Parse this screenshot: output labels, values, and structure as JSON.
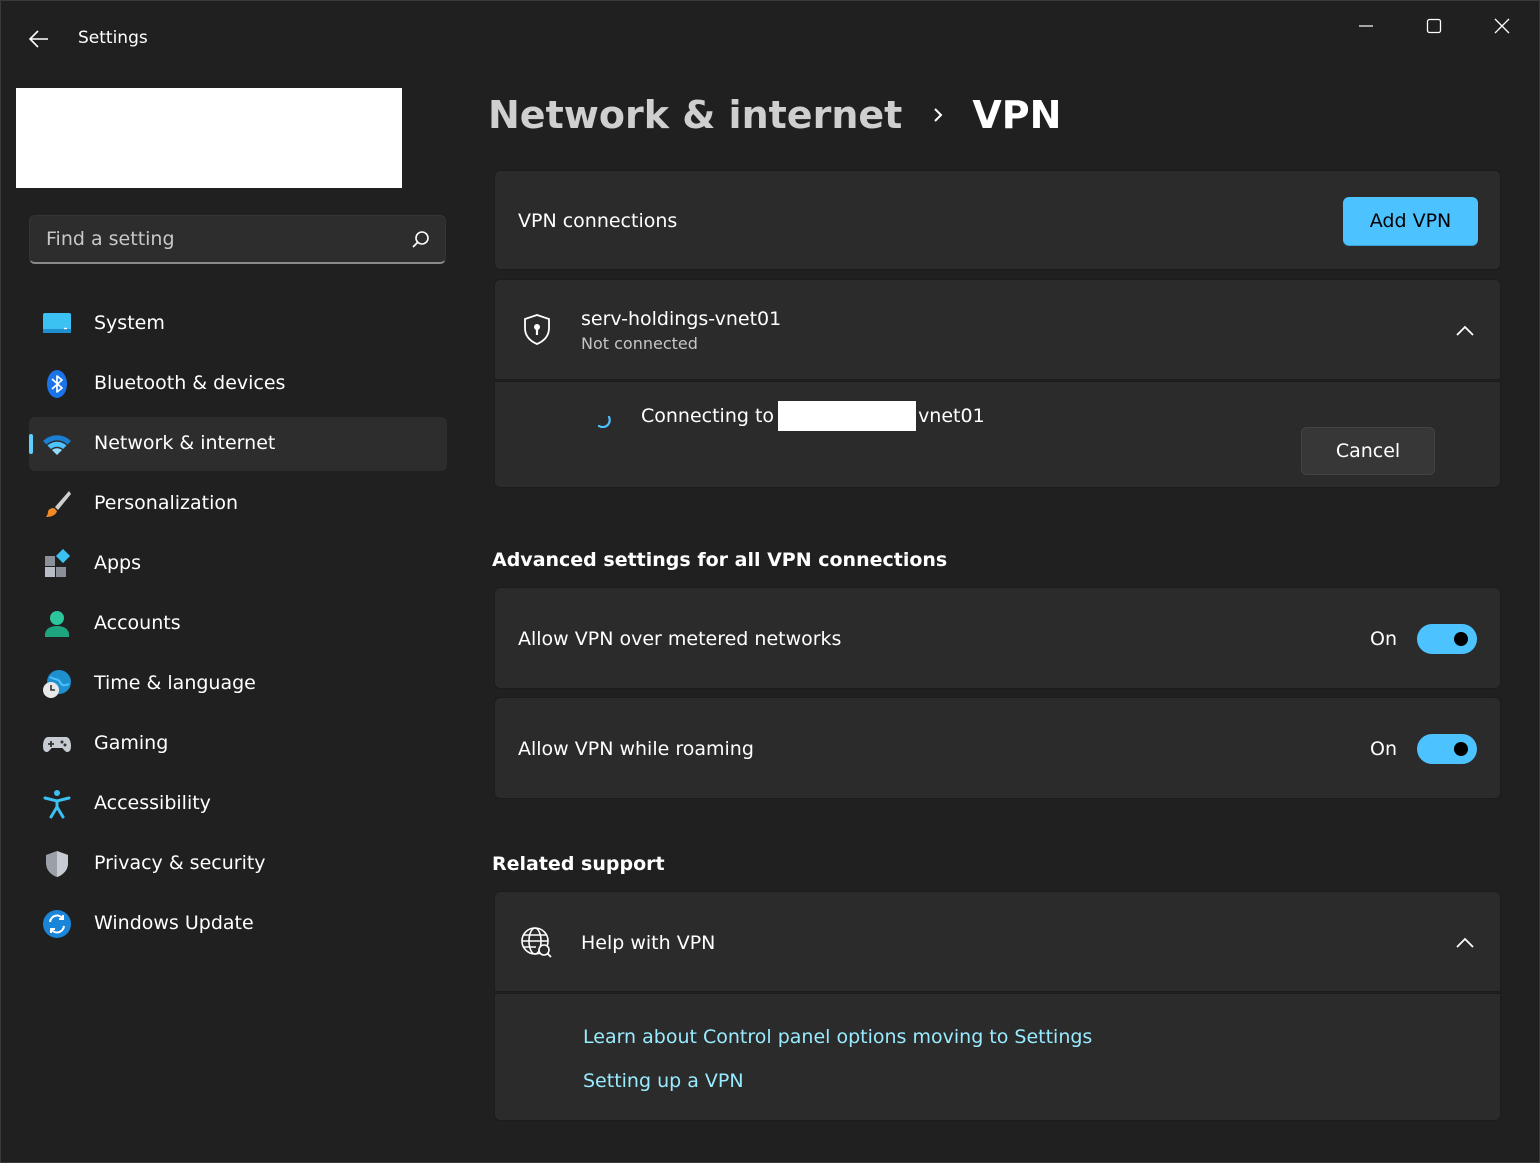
{
  "window": {
    "title": "Settings"
  },
  "search": {
    "placeholder": "Find a setting"
  },
  "sidebar": {
    "items": [
      {
        "label": "System",
        "icon": "monitor-icon"
      },
      {
        "label": "Bluetooth & devices",
        "icon": "bluetooth-icon"
      },
      {
        "label": "Network & internet",
        "icon": "wifi-icon",
        "active": true
      },
      {
        "label": "Personalization",
        "icon": "paintbrush-icon"
      },
      {
        "label": "Apps",
        "icon": "apps-icon"
      },
      {
        "label": "Accounts",
        "icon": "person-icon"
      },
      {
        "label": "Time & language",
        "icon": "globe-clock-icon"
      },
      {
        "label": "Gaming",
        "icon": "gamepad-icon"
      },
      {
        "label": "Accessibility",
        "icon": "accessibility-icon"
      },
      {
        "label": "Privacy & security",
        "icon": "shield-icon"
      },
      {
        "label": "Windows Update",
        "icon": "update-icon"
      }
    ]
  },
  "breadcrumb": {
    "parent": "Network & internet",
    "current": "VPN"
  },
  "vpn_connections": {
    "title": "VPN connections",
    "add_label": "Add VPN"
  },
  "vpn_item": {
    "name": "serv-holdings-vnet01",
    "status": "Not connected",
    "connecting_prefix": "Connecting to",
    "connecting_suffix": "vnet01",
    "cancel_label": "Cancel"
  },
  "advanced": {
    "title": "Advanced settings for all VPN connections",
    "metered": {
      "label": "Allow VPN over metered networks",
      "state": "On",
      "on": true
    },
    "roaming": {
      "label": "Allow VPN while roaming",
      "state": "On",
      "on": true
    }
  },
  "related": {
    "title": "Related support",
    "help_title": "Help with VPN",
    "links": [
      "Learn about Control panel options moving to Settings",
      "Setting up a VPN"
    ]
  },
  "colors": {
    "accent": "#4cc2ff",
    "background": "#202020",
    "card": "#2b2b2b",
    "link": "#99ebff"
  }
}
